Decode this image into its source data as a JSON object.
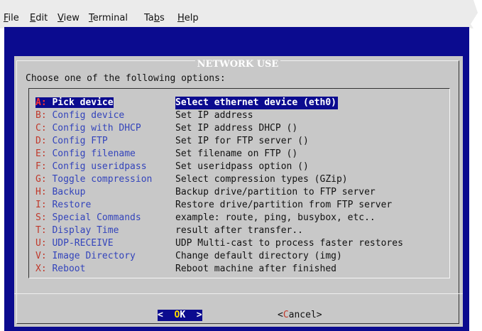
{
  "menubar": {
    "file": {
      "hot": "F",
      "rest": "ile"
    },
    "edit": {
      "hot": "E",
      "rest": "dit"
    },
    "view": {
      "hot": "V",
      "rest": "iew"
    },
    "terminal": {
      "hot": "T",
      "rest": "erminal"
    },
    "tabs": {
      "pre": "Ta",
      "hot": "b",
      "rest": "s"
    },
    "help": {
      "hot": "H",
      "rest": "elp"
    }
  },
  "dialog": {
    "title": "NETWORK USE",
    "prompt": "Choose one of the following options:",
    "items": [
      {
        "key": "A:",
        "label": " Pick device",
        "desc": "Select ethernet device (eth0)",
        "selected": true
      },
      {
        "key": "B:",
        "label": " Config device",
        "desc": "Set IP address"
      },
      {
        "key": "C:",
        "label": " Config with DHCP",
        "desc": "Set IP address DHCP ()"
      },
      {
        "key": "D:",
        "label": " Config FTP",
        "desc": "Set IP for FTP server ()"
      },
      {
        "key": "E:",
        "label": " Config filename",
        "desc": "Set filename on FTP ()"
      },
      {
        "key": "F:",
        "label": " Config useridpass",
        "desc": "Set useridpass option ()"
      },
      {
        "key": "G:",
        "label": " Toggle compression",
        "desc": "Select compression types (GZip)"
      },
      {
        "key": "H:",
        "label": " Backup",
        "desc": "Backup drive/partition to FTP server"
      },
      {
        "key": "I:",
        "label": " Restore",
        "desc": "Restore drive/partition from FTP server"
      },
      {
        "key": "S:",
        "label": " Special Commands",
        "desc": "example: route, ping, busybox, etc.."
      },
      {
        "key": "T:",
        "label": " Display Time",
        "desc": "result after transfer.."
      },
      {
        "key": "U:",
        "label": " UDP-RECEIVE",
        "desc": "UDP Multi-cast to process faster restores"
      },
      {
        "key": "V:",
        "label": " Image Directory",
        "desc": "Change default directory (img)"
      },
      {
        "key": "X:",
        "label": " Reboot",
        "desc": "Reboot machine after finished"
      }
    ],
    "buttons": {
      "ok": {
        "left": "<  ",
        "hot": "O",
        "rest": "K  >"
      },
      "cancel": {
        "left": "<",
        "hot": "C",
        "rest": "ancel>"
      }
    }
  },
  "colors": {
    "terminal_bg": "#0b0b8f",
    "dialog_bg": "#c8c8c8",
    "hotkey": "#c0392b",
    "label": "#3344bb"
  }
}
